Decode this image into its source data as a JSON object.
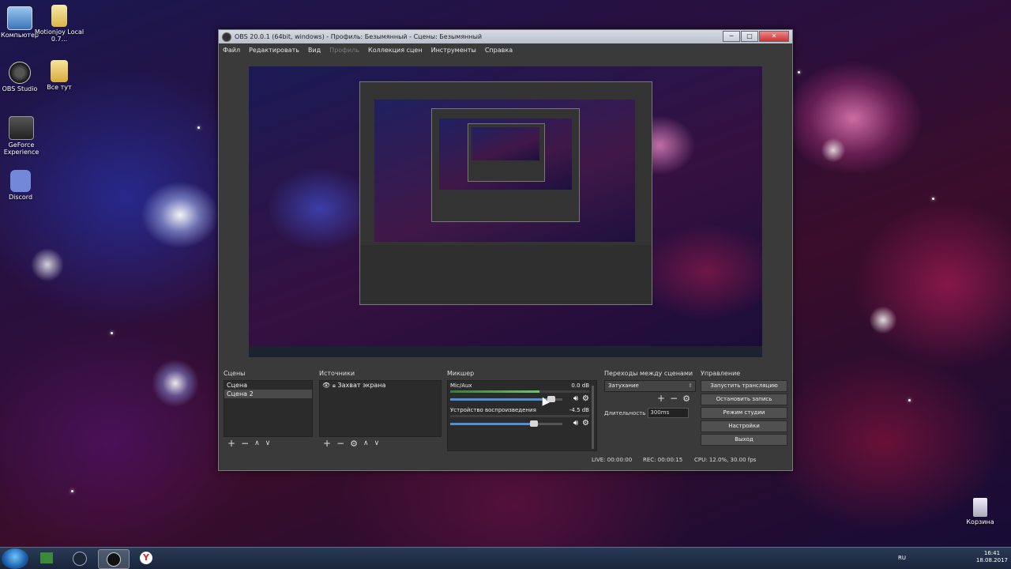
{
  "desktop": {
    "icons": [
      {
        "name": "computer-icon",
        "label": "Компьютер"
      },
      {
        "name": "motionjoy-icon",
        "label": "Motionjoy Local 0.7..."
      },
      {
        "name": "obs-studio-icon",
        "label": "OBS Studio"
      },
      {
        "name": "folder-icon",
        "label": "Все тут"
      },
      {
        "name": "geforce-icon",
        "label": "GeForce Experience"
      },
      {
        "name": "discord-icon",
        "label": "Discord"
      },
      {
        "name": "recycle-bin-icon",
        "label": "Корзина"
      }
    ]
  },
  "window": {
    "title": "OBS 20.0.1 (64bit, windows) - Профиль: Безымянный - Сцены: Безымянный",
    "buttons": {
      "minimize": "─",
      "maximize": "□",
      "close": "✕"
    }
  },
  "menu": {
    "items": [
      "Файл",
      "Редактировать",
      "Вид",
      "Профиль",
      "Коллекция сцен",
      "Инструменты",
      "Справка"
    ]
  },
  "scenes": {
    "title": "Сцены",
    "items": [
      "Сцена",
      "Сцена 2"
    ],
    "tools": {
      "add": "+",
      "remove": "−",
      "up": "∧",
      "down": "∨"
    }
  },
  "sources": {
    "title": "Источники",
    "items": [
      {
        "label": "Захват экрана"
      }
    ],
    "tools": {
      "add": "+",
      "remove": "−",
      "settings": "⚙",
      "up": "∧",
      "down": "∨"
    }
  },
  "mixer": {
    "title": "Микшер",
    "channels": [
      {
        "name": "Mic/Aux",
        "db": "0.0 dB",
        "level": 0.64,
        "volume": 0.94
      },
      {
        "name": "Устройство воспроизведения",
        "db": "-4.5 dB",
        "level": 0.0,
        "volume": 0.78
      }
    ]
  },
  "transitions": {
    "title": "Переходы между сценами",
    "selected": "Затухание",
    "duration_label": "Длительность",
    "duration_value": "300ms",
    "tools": {
      "add": "+",
      "remove": "−",
      "settings": "⚙"
    }
  },
  "controls": {
    "title": "Управление",
    "buttons": [
      "Запустить трансляцию",
      "Остановить запись",
      "Режим студии",
      "Настройки",
      "Выход"
    ]
  },
  "status": {
    "live": "LIVE: 00:00:00",
    "rec": "REC: 00:00:15",
    "cpu": "CPU: 12.0%, 30.00 fps"
  },
  "taskbar": {
    "lang": "RU",
    "time": "16:41",
    "date": "18.08.2017"
  }
}
